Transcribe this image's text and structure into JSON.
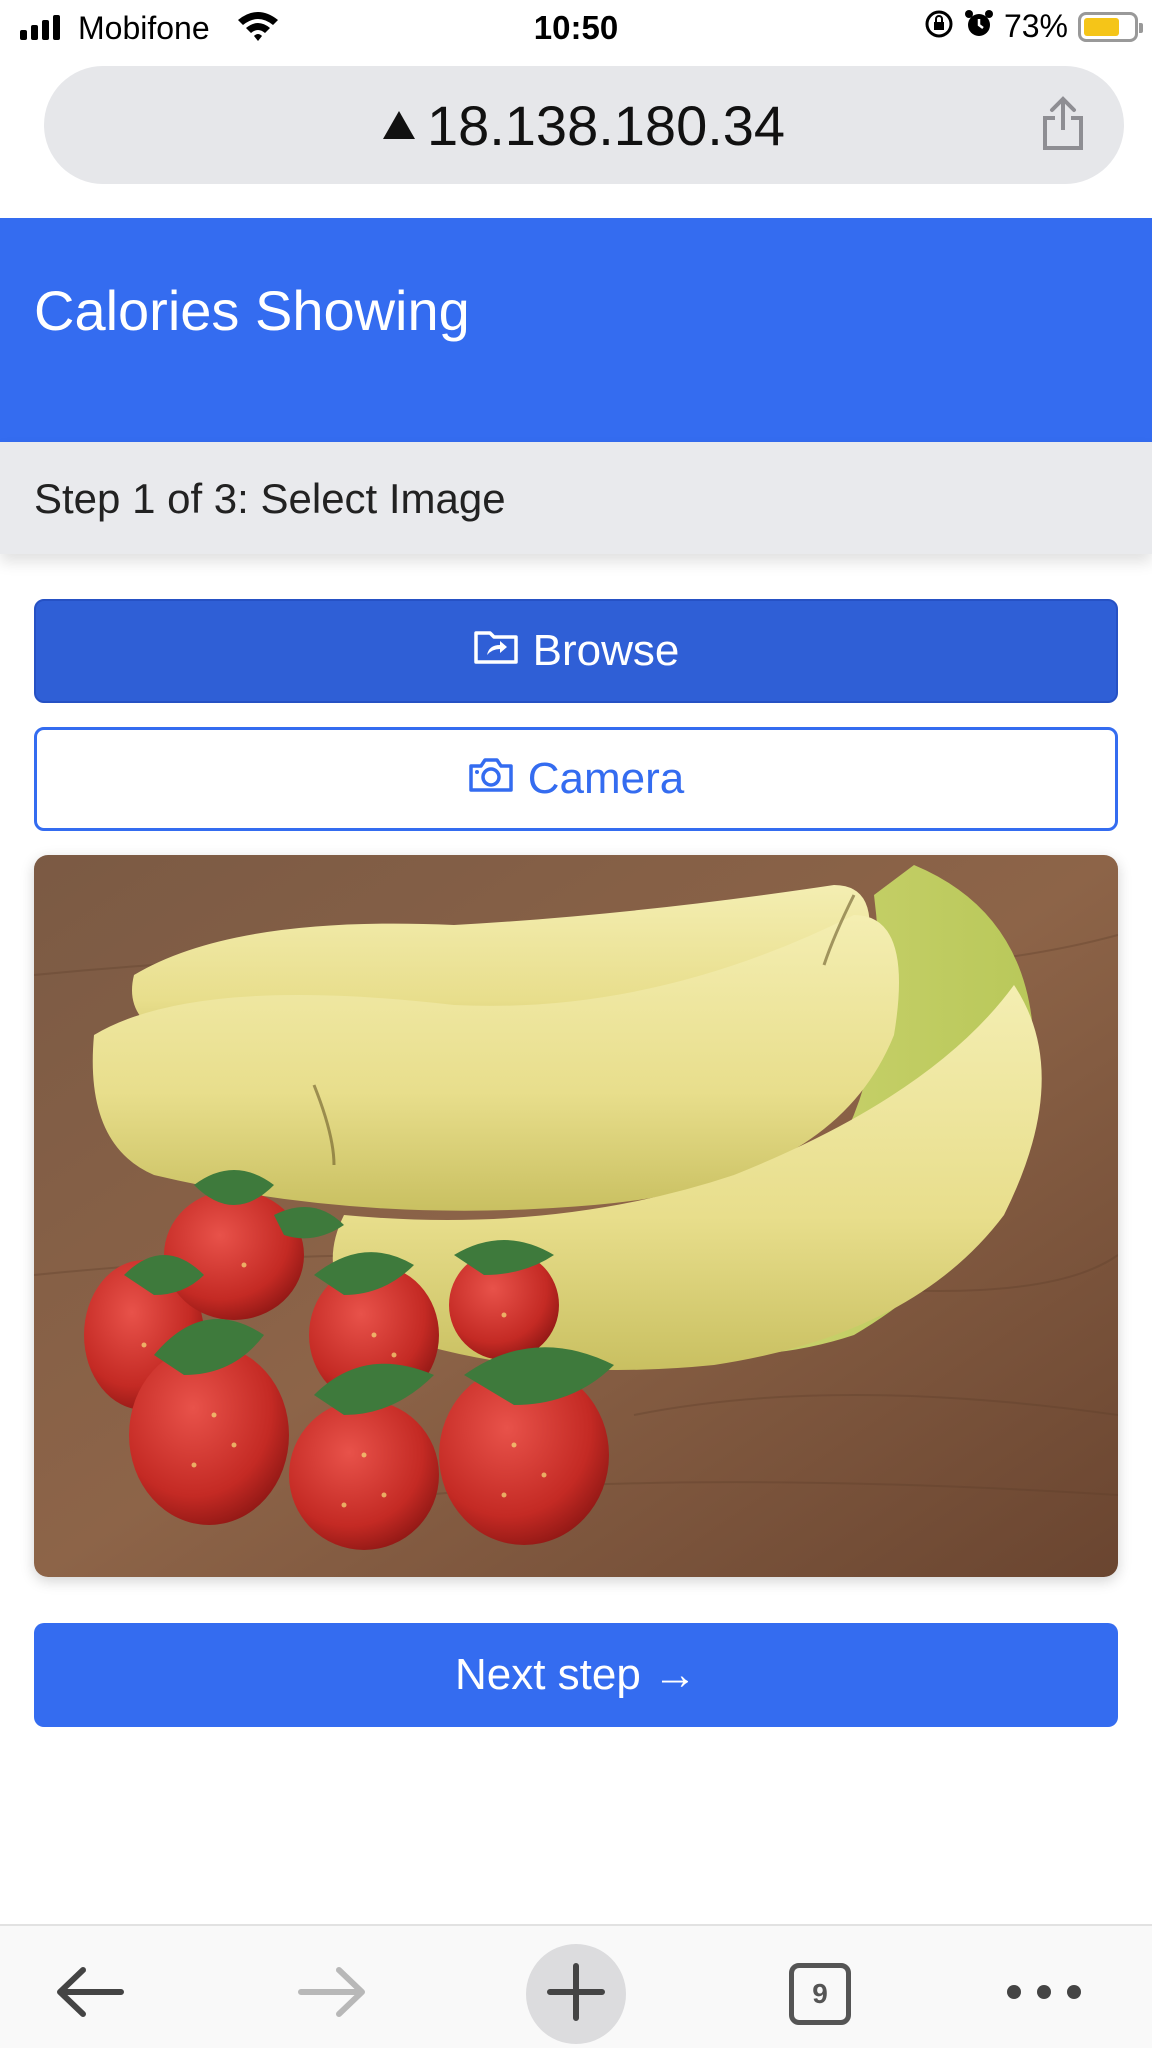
{
  "status_bar": {
    "carrier": "Mobifone",
    "time": "10:50",
    "battery_percent": "73%",
    "battery_level": 0.73,
    "icons": [
      "signal-icon",
      "wifi-icon",
      "orientation-lock-icon",
      "alarm-icon",
      "battery-icon"
    ]
  },
  "browser": {
    "url": "18.138.180.34",
    "url_warning_icon": "warning-triangle-icon",
    "share_icon": "share-icon",
    "toolbar": {
      "back_icon": "arrow-left-icon",
      "forward_icon": "arrow-right-icon",
      "new_tab_icon": "plus-icon",
      "tab_count": "9",
      "more_icon": "ellipsis-icon"
    }
  },
  "app": {
    "title": "Calories Showing",
    "step_label": "Step 1 of 3: Select Image",
    "buttons": {
      "browse": "Browse",
      "camera": "Camera",
      "next": "Next step →"
    },
    "button_icons": {
      "browse": "folder-share-icon",
      "camera": "camera-icon"
    },
    "colors": {
      "primary": "#346cf0",
      "browse_bg": "#2f5fd6",
      "step_bg": "#e9eaed"
    }
  }
}
